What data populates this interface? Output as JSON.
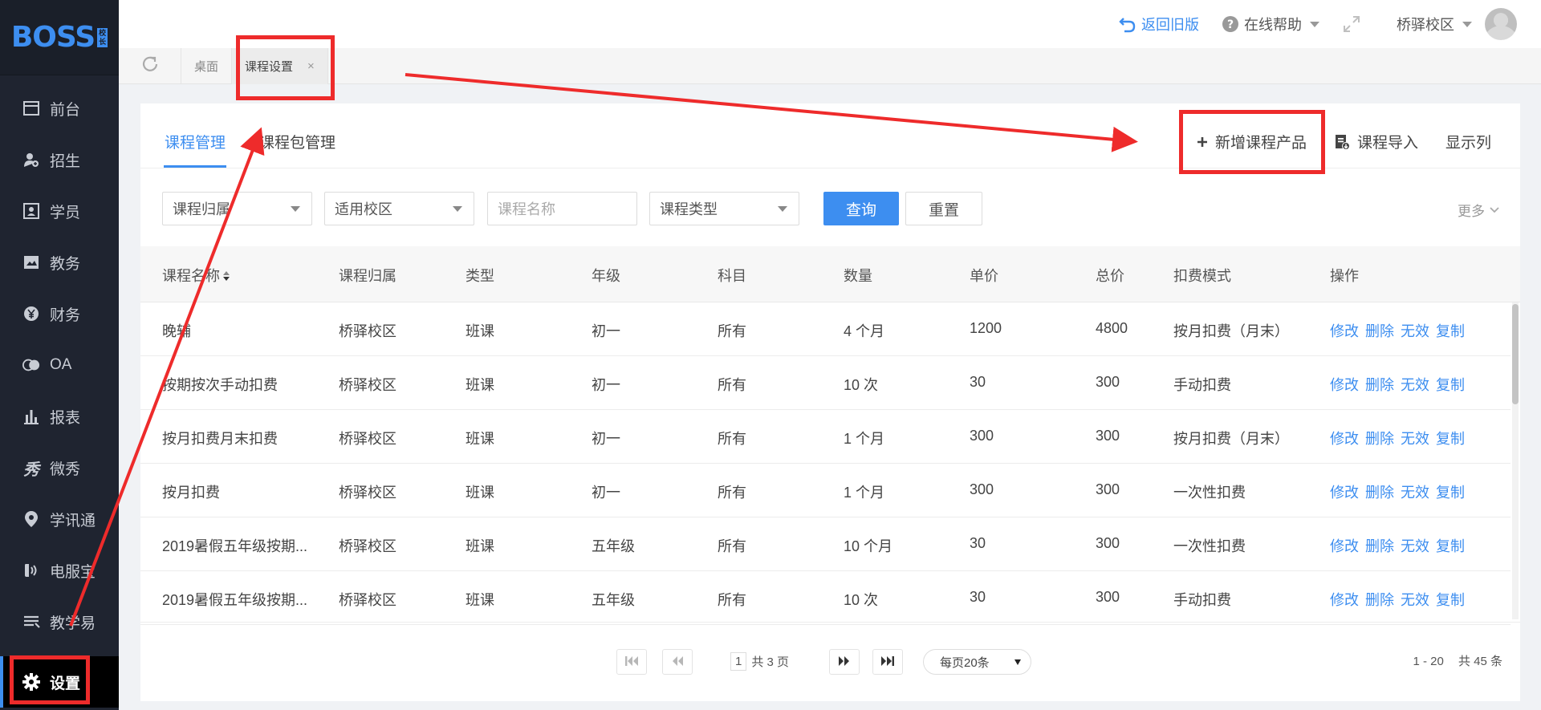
{
  "app": {
    "logo_text": "BOSS",
    "logo_badge_chars": [
      "校",
      "长"
    ]
  },
  "sidebar": {
    "items": [
      {
        "label": "前台",
        "icon": "window-icon"
      },
      {
        "label": "招生",
        "icon": "user-add-icon"
      },
      {
        "label": "学员",
        "icon": "student-card-icon"
      },
      {
        "label": "教务",
        "icon": "book-icon"
      },
      {
        "label": "财务",
        "icon": "yen-coin-icon"
      },
      {
        "label": "OA",
        "icon": "oa-toggle-icon"
      },
      {
        "label": "报表",
        "icon": "bar-chart-icon"
      },
      {
        "label": "微秀",
        "icon": "weixiu-icon"
      },
      {
        "label": "学讯通",
        "icon": "location-pin-icon"
      },
      {
        "label": "电服宝",
        "icon": "phone-service-icon"
      },
      {
        "label": "教学易",
        "icon": "teaching-icon"
      },
      {
        "label": "设置",
        "icon": "gear-icon",
        "active": true
      }
    ]
  },
  "header": {
    "back_old_label": "返回旧版",
    "help_label": "在线帮助",
    "campus_label": "桥驿校区"
  },
  "page_tabs": {
    "items": [
      {
        "label": "桌面"
      },
      {
        "label": "课程设置",
        "active": true,
        "close": "×"
      }
    ]
  },
  "main": {
    "subtabs": [
      {
        "label": "课程管理",
        "active": true
      },
      {
        "label": "课程包管理"
      }
    ],
    "actions": {
      "add_label": "新增课程产品",
      "import_label": "课程导入",
      "columns_label": "显示列"
    },
    "filters": {
      "course_owner": "课程归属",
      "campus": "适用校区",
      "course_name_placeholder": "课程名称",
      "course_type": "课程类型",
      "query_label": "查询",
      "reset_label": "重置",
      "more_label": "更多"
    },
    "table": {
      "columns": [
        "课程名称",
        "课程归属",
        "类型",
        "年级",
        "科目",
        "数量",
        "单价",
        "总价",
        "扣费模式",
        "操作"
      ],
      "row_actions": [
        "修改",
        "删除",
        "无效",
        "复制"
      ],
      "rows": [
        [
          "晚辅",
          "桥驿校区",
          "班课",
          "初一",
          "所有",
          "4 个月",
          "1200",
          "4800",
          "按月扣费（月末）"
        ],
        [
          "按期按次手动扣费",
          "桥驿校区",
          "班课",
          "初一",
          "所有",
          "10 次",
          "30",
          "300",
          "手动扣费"
        ],
        [
          "按月扣费月末扣费",
          "桥驿校区",
          "班课",
          "初一",
          "所有",
          "1 个月",
          "300",
          "300",
          "按月扣费（月末）"
        ],
        [
          "按月扣费",
          "桥驿校区",
          "班课",
          "初一",
          "所有",
          "1 个月",
          "300",
          "300",
          "一次性扣费"
        ],
        [
          "2019暑假五年级按期...",
          "桥驿校区",
          "班课",
          "五年级",
          "所有",
          "10 个月",
          "30",
          "300",
          "一次性扣费"
        ],
        [
          "2019暑假五年级按期...",
          "桥驿校区",
          "班课",
          "五年级",
          "所有",
          "10 次",
          "30",
          "300",
          "手动扣费"
        ]
      ]
    },
    "pagination": {
      "current_page": "1",
      "total_pages_text": "共 3 页",
      "page_size_label": "每页20条",
      "range_text": "1 - 20",
      "total_text": "共 45 条"
    }
  },
  "colors": {
    "accent": "#3d8ef0",
    "sidebar_bg": "#1f2430",
    "annotation": "#ee2b2b"
  }
}
